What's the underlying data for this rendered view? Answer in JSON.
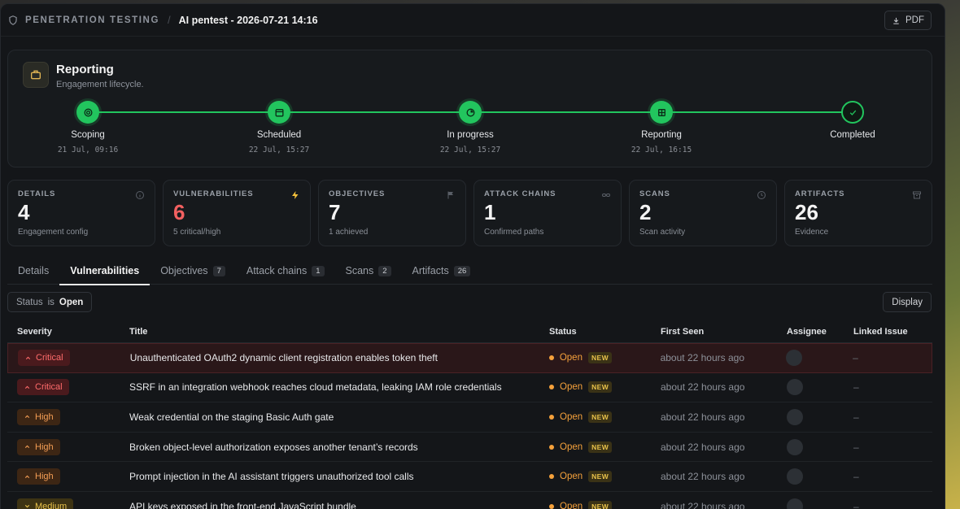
{
  "header": {
    "section": "PENETRATION TESTING",
    "title": "AI pentest - 2026-07-21 14:16",
    "pdf_label": "PDF"
  },
  "lifecycle": {
    "title": "Reporting",
    "subtitle": "Engagement lifecycle.",
    "stages": [
      {
        "label": "Scoping",
        "date": "21 Jul, 09:16",
        "icon": "target-icon"
      },
      {
        "label": "Scheduled",
        "date": "22 Jul, 15:27",
        "icon": "calendar-icon"
      },
      {
        "label": "In progress",
        "date": "22 Jul, 15:27",
        "icon": "progress-icon"
      },
      {
        "label": "Reporting",
        "date": "22 Jul, 16:15",
        "icon": "grid-icon"
      },
      {
        "label": "Completed",
        "date": "",
        "icon": "check-icon"
      }
    ]
  },
  "cards": [
    {
      "label": "DETAILS",
      "value": "4",
      "note": "Engagement config",
      "icon": "info-icon"
    },
    {
      "label": "VULNERABILITIES",
      "value": "6",
      "note": "5 critical/high",
      "icon": "bolt-icon"
    },
    {
      "label": "OBJECTIVES",
      "value": "7",
      "note": "1 achieved",
      "icon": "flag-icon"
    },
    {
      "label": "ATTACK CHAINS",
      "value": "1",
      "note": "Confirmed paths",
      "icon": "chain-icon"
    },
    {
      "label": "SCANS",
      "value": "2",
      "note": "Scan activity",
      "icon": "clock-icon"
    },
    {
      "label": "ARTIFACTS",
      "value": "26",
      "note": "Evidence",
      "icon": "archive-icon"
    }
  ],
  "tabs": [
    {
      "label": "Details",
      "count": ""
    },
    {
      "label": "Vulnerabilities",
      "count": ""
    },
    {
      "label": "Objectives",
      "count": "7"
    },
    {
      "label": "Attack chains",
      "count": "1"
    },
    {
      "label": "Scans",
      "count": "2"
    },
    {
      "label": "Artifacts",
      "count": "26"
    }
  ],
  "filter": {
    "field": "Status",
    "op": "is",
    "value": "Open"
  },
  "display_label": "Display",
  "table": {
    "headers": {
      "severity": "Severity",
      "title": "Title",
      "status": "Status",
      "first_seen": "First Seen",
      "assignee": "Assignee",
      "linked": "Linked Issue"
    },
    "rows": [
      {
        "severity": "Critical",
        "title": "Unauthenticated OAuth2 dynamic client registration enables token theft",
        "status": "Open",
        "badge": "NEW",
        "seen": "about 22 hours ago",
        "linked": "–"
      },
      {
        "severity": "Critical",
        "title": "SSRF in an integration webhook reaches cloud metadata, leaking IAM role credentials",
        "status": "Open",
        "badge": "NEW",
        "seen": "about 22 hours ago",
        "linked": "–"
      },
      {
        "severity": "High",
        "title": "Weak credential on the staging Basic Auth gate",
        "status": "Open",
        "badge": "NEW",
        "seen": "about 22 hours ago",
        "linked": "–"
      },
      {
        "severity": "High",
        "title": "Broken object-level authorization exposes another tenant’s records",
        "status": "Open",
        "badge": "NEW",
        "seen": "about 22 hours ago",
        "linked": "–"
      },
      {
        "severity": "High",
        "title": "Prompt injection in the AI assistant triggers unauthorized tool calls",
        "status": "Open",
        "badge": "NEW",
        "seen": "about 22 hours ago",
        "linked": "–"
      },
      {
        "severity": "Medium",
        "title": "API keys exposed in the front-end JavaScript bundle",
        "status": "Open",
        "badge": "NEW",
        "seen": "about 22 hours ago",
        "linked": "–"
      }
    ]
  },
  "colors": {
    "accent_green": "#22c55e",
    "critical": "#ff6b6b",
    "high": "#f59e55",
    "medium": "#e8c14a",
    "open": "#f5a13b"
  }
}
